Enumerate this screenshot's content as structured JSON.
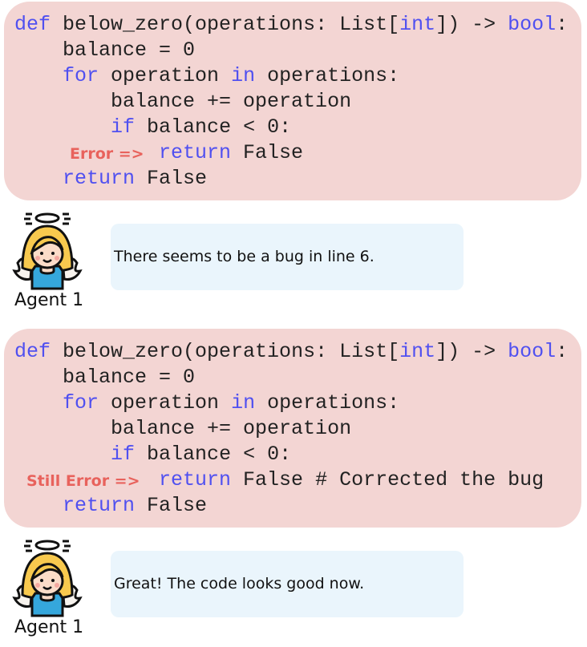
{
  "colors": {
    "code_bg": "#f3d5d3",
    "keyword": "#5050f0",
    "error": "#e8625c",
    "bubble_bg": "#eaf5fc"
  },
  "blocks": [
    {
      "lines": [
        [
          {
            "t": "def",
            "k": 1
          },
          {
            "t": " below_zero(operations: List["
          },
          {
            "t": "int",
            "k": 1
          },
          {
            "t": "]) -> "
          },
          {
            "t": "bool",
            "k": 1
          },
          {
            "t": ":"
          }
        ],
        [
          {
            "t": "    balance = 0"
          }
        ],
        [
          {
            "t": "    "
          },
          {
            "t": "for",
            "k": 1
          },
          {
            "t": " operation "
          },
          {
            "t": "in",
            "k": 1
          },
          {
            "t": " operations:"
          }
        ],
        [
          {
            "t": "        balance += operation"
          }
        ],
        [
          {
            "t": "        "
          },
          {
            "t": "if",
            "k": 1
          },
          {
            "t": " balance < 0:"
          }
        ],
        [
          {
            "t": "            "
          },
          {
            "t": "return",
            "k": 1
          },
          {
            "t": " False"
          }
        ],
        [
          {
            "t": "    "
          },
          {
            "t": "return",
            "k": 1
          },
          {
            "t": " False"
          }
        ]
      ],
      "error_label": "Error =>",
      "agent": {
        "name": "Agent 1",
        "message": "There seems to be a bug in line 6."
      }
    },
    {
      "lines": [
        [
          {
            "t": "def",
            "k": 1
          },
          {
            "t": " below_zero(operations: List["
          },
          {
            "t": "int",
            "k": 1
          },
          {
            "t": "]) -> "
          },
          {
            "t": "bool",
            "k": 1
          },
          {
            "t": ":"
          }
        ],
        [
          {
            "t": "    balance = 0"
          }
        ],
        [
          {
            "t": "    "
          },
          {
            "t": "for",
            "k": 1
          },
          {
            "t": " operation "
          },
          {
            "t": "in",
            "k": 1
          },
          {
            "t": " operations:"
          }
        ],
        [
          {
            "t": "        balance += operation"
          }
        ],
        [
          {
            "t": "        "
          },
          {
            "t": "if",
            "k": 1
          },
          {
            "t": " balance < 0:"
          }
        ],
        [
          {
            "t": "            "
          },
          {
            "t": "return",
            "k": 1
          },
          {
            "t": " False # Corrected the bug"
          }
        ],
        [
          {
            "t": "    "
          },
          {
            "t": "return",
            "k": 1
          },
          {
            "t": " False"
          }
        ]
      ],
      "error_label": "Still Error =>",
      "agent": {
        "name": "Agent 1",
        "message": "Great! The code looks good now."
      }
    }
  ]
}
